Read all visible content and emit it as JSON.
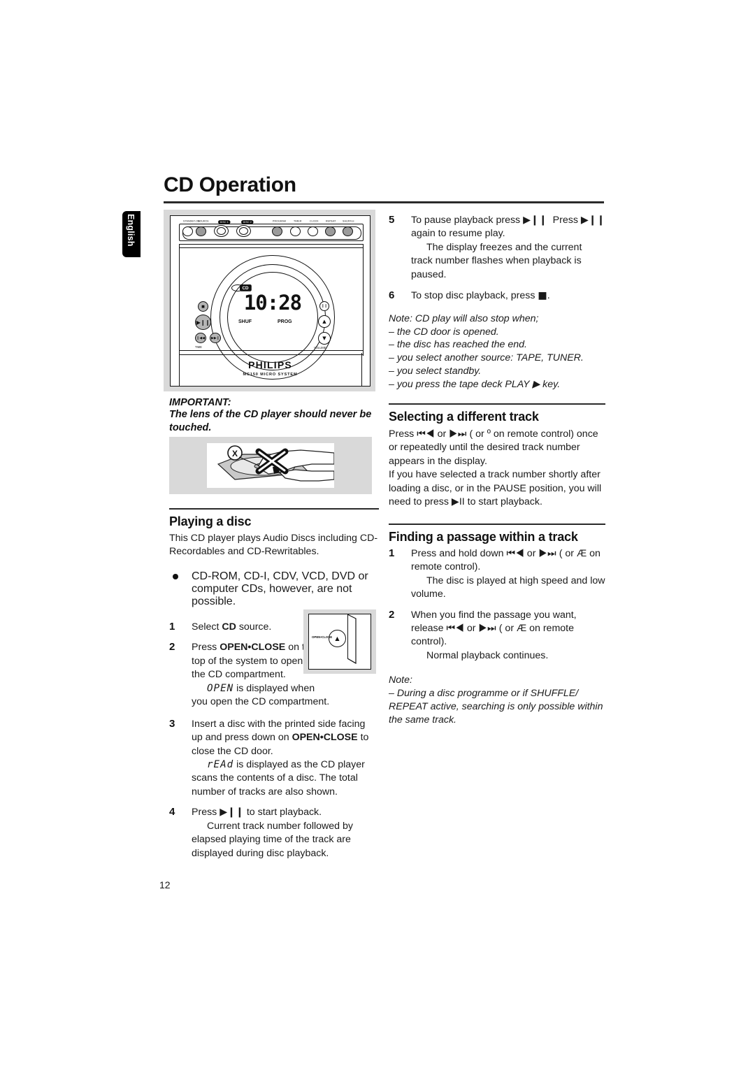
{
  "page": {
    "title": "CD Operation",
    "language_tab": "English",
    "page_number": "12"
  },
  "device_figure": {
    "brand": "PHILIPS",
    "model": "MC150 MICRO SYSTEM",
    "display_value": "10:28",
    "display_cd_indicator": "CD",
    "display_shuffle_label": "SHUF",
    "display_program_label": "PROG",
    "volume_label": "VOLUME",
    "time_label": "TIME",
    "top_buttons": [
      {
        "label": "STANDBY-ON",
        "style": "plain"
      },
      {
        "label": "SOURCE",
        "style": "filled"
      },
      {
        "label": "DISC 1",
        "style": "pill"
      },
      {
        "label": "DISC 2",
        "style": "pill"
      },
      {
        "label": "PROGRAM",
        "style": "filled"
      },
      {
        "label": "TIMER",
        "style": "plain"
      },
      {
        "label": "CLOCK",
        "style": "plain"
      },
      {
        "label": "REPEAT",
        "style": "filled"
      },
      {
        "label": "SHUFFLE",
        "style": "filled"
      }
    ],
    "transport_buttons": [
      "stop",
      "play-pause",
      "previous",
      "next"
    ],
    "side_buttons": [
      "record",
      "volume-up",
      "volume-down"
    ]
  },
  "important": {
    "heading": "IMPORTANT:",
    "body": "The lens of the CD player should never be touched.",
    "figure_caption": "lens-warning-illustration"
  },
  "open_close_figure": {
    "button_label": "OPEN•CLOSE",
    "icon": "eject-triangle"
  },
  "left_column": {
    "section_title": "Playing a disc",
    "intro": "This CD player plays Audio Discs including CD-Recordables and CD-Rewritables.",
    "bullet": "CD-ROM, CD-I, CDV, VCD, DVD or computer CDs, however, are not possible.",
    "steps": [
      {
        "number": "1",
        "lines": [
          {
            "type": "text",
            "content": "Select CD source.",
            "bold_parts": [
              "CD"
            ]
          }
        ]
      },
      {
        "number": "2",
        "lines": [
          {
            "type": "text",
            "content": "Press OPEN•CLOSE on the top of the system to open the CD compartment.",
            "bold_parts": [
              "OPEN•CLOSE"
            ]
          },
          {
            "type": "indent-lcd",
            "lcd": "OPEN",
            "content": " is displayed when you open the CD compartment."
          }
        ]
      },
      {
        "number": "3",
        "lines": [
          {
            "type": "text",
            "content": "Insert a disc with the printed side facing up and press down on OPEN•CLOSE to close the CD door.",
            "bold_parts": [
              "OPEN•CLOSE"
            ]
          },
          {
            "type": "indent-lcd",
            "lcd": "rEAd",
            "content": " is displayed as the CD player scans the contents of a disc. The total number of tracks are also shown."
          }
        ]
      },
      {
        "number": "4",
        "lines": [
          {
            "type": "text-symbol",
            "pre": "Press ",
            "symbol": "▶II",
            "post": " to start playback."
          },
          {
            "type": "indent",
            "content": "Current track number followed by elapsed playing time of the track are displayed during disc playback."
          }
        ]
      }
    ]
  },
  "right_column": {
    "steps_top": [
      {
        "number": "5",
        "lines": [
          {
            "type": "text-symbol2",
            "pre": "To pause playback press ",
            "symbol": "▶II",
            "mid": "  Press ",
            "symbol2": "▶II",
            "post": " again to resume play."
          },
          {
            "type": "indent",
            "content": "The display freezes and the current track number flashes when playback is paused."
          }
        ]
      },
      {
        "number": "6",
        "lines": [
          {
            "type": "text-stop",
            "pre": "To stop disc playback, press ",
            "symbol": "■",
            "post": "."
          }
        ]
      }
    ],
    "note_stop": {
      "heading": "Note: CD play will also stop when;",
      "items": [
        "– the CD door is opened.",
        "– the disc has reached the end.",
        "– you select another source: TAPE, TUNER.",
        "– you select standby.",
        "– you press the tape deck PLAY ▶ key."
      ]
    },
    "section_track": {
      "title": "Selecting a different track",
      "paragraphs": [
        "Press ⏮◀ or ▶⏭ (     or º     on remote control) once or repeatedly until the desired track number appears in the display.",
        "If you have selected a track number shortly after loading a disc, or in the PAUSE position, you will need to press ▶II to start playback."
      ]
    },
    "section_passage": {
      "title": "Finding a passage within a track",
      "steps": [
        {
          "number": "1",
          "lines": [
            {
              "type": "text",
              "content": "Press and hold down ⏮◀ or ▶⏭ (     or Æ  on remote control)."
            },
            {
              "type": "indent",
              "content": "The disc is played at high speed and low volume."
            }
          ]
        },
        {
          "number": "2",
          "lines": [
            {
              "type": "text",
              "content": "When you find the passage you want, release ⏮◀ or ▶⏭ (     or Æ  on remote control)."
            },
            {
              "type": "indent",
              "content": "Normal playback continues."
            }
          ]
        }
      ],
      "note": {
        "heading": "Note:",
        "body": "–  During a disc programme or if SHUFFLE/ REPEAT active, searching is only possible within the same track."
      }
    }
  },
  "colors": {
    "rule": "#2a2a2a",
    "figure_bg": "#d9d9d9",
    "button_fill": "#9b9b9b",
    "text": "#1a1a1a"
  }
}
